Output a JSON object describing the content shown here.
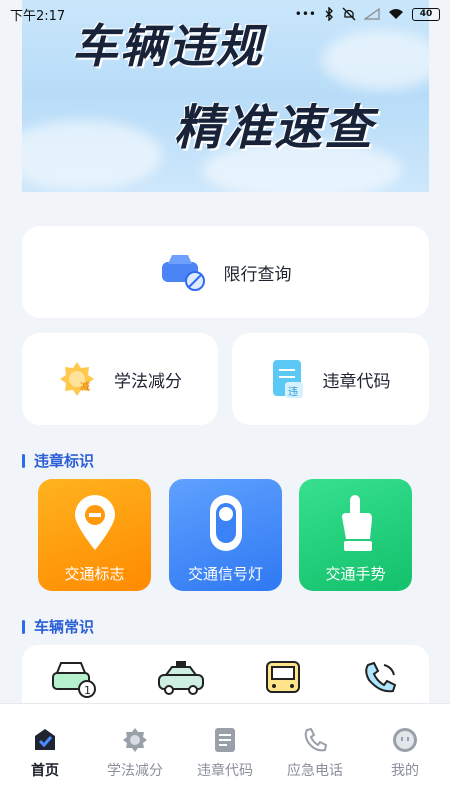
{
  "status_bar": {
    "time": "下午2:17",
    "signal_dots": "•••",
    "battery": "40"
  },
  "banner": {
    "line1": "车辆违规",
    "line2": "精准速查"
  },
  "cards": {
    "restrict": "限行查询",
    "study": "学法减分",
    "codes": "违章代码"
  },
  "sections": {
    "violation_signs": "违章标识",
    "vehicle_knowledge": "车辆常识"
  },
  "tiles": [
    {
      "label": "交通标志",
      "icon": "location-pin-icon",
      "color": "#ff9a0e"
    },
    {
      "label": "交通信号灯",
      "icon": "traffic-light-icon",
      "color": "#3b82f6"
    },
    {
      "label": "交通手势",
      "icon": "hand-gesture-icon",
      "color": "#1cc872"
    }
  ],
  "knowledge_icons": [
    "car-one-icon",
    "taxi-icon",
    "bus-icon",
    "phone-icon"
  ],
  "nav": [
    {
      "label": "首页",
      "icon": "home-icon",
      "active": true
    },
    {
      "label": "学法减分",
      "icon": "badge-icon",
      "active": false
    },
    {
      "label": "违章代码",
      "icon": "document-icon",
      "active": false
    },
    {
      "label": "应急电话",
      "icon": "phone-icon",
      "active": false
    },
    {
      "label": "我的",
      "icon": "profile-icon",
      "active": false
    }
  ],
  "colors": {
    "accent": "#2a6cf0",
    "background": "#f1f4f9"
  }
}
